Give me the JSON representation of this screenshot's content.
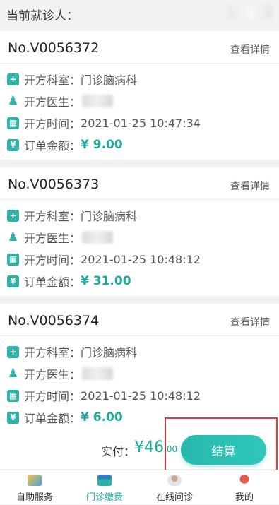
{
  "header": {
    "patient_label": "当前就诊人："
  },
  "orders": [
    {
      "order_no": "No.V0056372",
      "detail_link": "查看详情",
      "department_label": "开方科室：",
      "department": "门诊脑病科",
      "doctor_label": "开方医生：",
      "time_label": "开方时间：",
      "time": "2021-01-25 10:47:34",
      "amount_label": "订单金额：",
      "amount": "¥ 9.00"
    },
    {
      "order_no": "No.V0056373",
      "detail_link": "查看详情",
      "department_label": "开方科室：",
      "department": "门诊脑病科",
      "doctor_label": "开方医生：",
      "time_label": "开方时间：",
      "time": "2021-01-25 10:48:12",
      "amount_label": "订单金额：",
      "amount": "¥ 31.00"
    },
    {
      "order_no": "No.V0056374",
      "detail_link": "查看详情",
      "department_label": "开方科室：",
      "department": "门诊脑病科",
      "doctor_label": "开方医生：",
      "time_label": "开方时间：",
      "time": "2021-01-25 10:48:12",
      "amount_label": "订单金额：",
      "amount": "¥ 6.00"
    }
  ],
  "payment": {
    "label": "实付：",
    "currency": "¥",
    "amount_int": "46",
    "amount_dec": ".00",
    "checkout_label": "结算"
  },
  "tabbar": {
    "items": [
      {
        "label": "自助服务",
        "icon": "self-service-icon",
        "active": false
      },
      {
        "label": "门诊缴费",
        "icon": "card-payment-icon",
        "active": true
      },
      {
        "label": "在线问诊",
        "icon": "doctor-consult-icon",
        "active": false
      },
      {
        "label": "我的",
        "icon": "profile-icon",
        "active": false
      }
    ]
  },
  "colors": {
    "accent": "#1fa89d",
    "highlight": "#d93a3a"
  }
}
